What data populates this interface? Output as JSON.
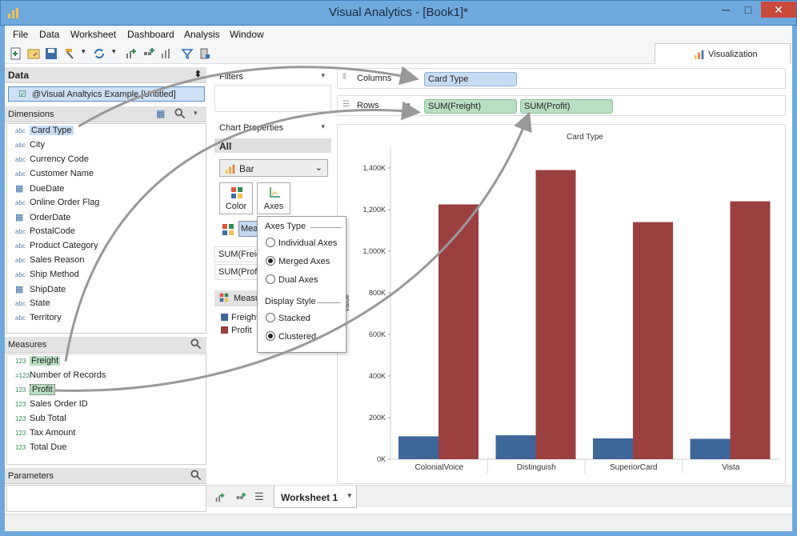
{
  "window": {
    "title": "Visual Analytics - [Book1]*",
    "min": "─",
    "max": "□",
    "close": "✕"
  },
  "menu": [
    "File",
    "Data",
    "Worksheet",
    "Dashboard",
    "Analysis",
    "Window"
  ],
  "toolbar": {
    "visualization_tab": "Visualization"
  },
  "data_pane": {
    "header": "Data",
    "source": "@Visual Analtyics Example [Untitled]",
    "dimensions_header": "Dimensions",
    "dimensions": [
      {
        "type": "abc",
        "name": "Card Type"
      },
      {
        "type": "abc",
        "name": "City"
      },
      {
        "type": "abc",
        "name": "Currency Code"
      },
      {
        "type": "abc",
        "name": "Customer Name"
      },
      {
        "type": "date",
        "name": "DueDate"
      },
      {
        "type": "abc",
        "name": "Online Order Flag"
      },
      {
        "type": "date",
        "name": "OrderDate"
      },
      {
        "type": "abc",
        "name": "PostalCode"
      },
      {
        "type": "abc",
        "name": "Product Category"
      },
      {
        "type": "abc",
        "name": "Sales Reason"
      },
      {
        "type": "abc",
        "name": "Ship Method"
      },
      {
        "type": "date",
        "name": "ShipDate"
      },
      {
        "type": "abc",
        "name": "State"
      },
      {
        "type": "abc",
        "name": "Territory"
      }
    ],
    "measures_header": "Measures",
    "measures": [
      {
        "type": "123",
        "name": "Freight"
      },
      {
        "type": "=123",
        "name": "Number of Records"
      },
      {
        "type": "123",
        "name": "Profit"
      },
      {
        "type": "123",
        "name": "Sales Order ID"
      },
      {
        "type": "123",
        "name": "Sub Total"
      },
      {
        "type": "123",
        "name": "Tax Amount"
      },
      {
        "type": "123",
        "name": "Total Due"
      }
    ],
    "parameters_header": "Parameters"
  },
  "middle": {
    "filters": "Filters",
    "chart_properties": "Chart Properties",
    "all": "All",
    "chart_type": "Bar",
    "color": "Color",
    "axes": "Axes",
    "measures_chip": "Measures",
    "sum_freight": "SUM(Freight)",
    "sum_profit": "SUM(Profit)",
    "measure_values": "Measure Values",
    "legend": [
      {
        "name": "Freight",
        "color": "#3d6699"
      },
      {
        "name": "Profit",
        "color": "#9b3f3f"
      }
    ]
  },
  "axes_popup": {
    "axes_type": "Axes Type",
    "options_type": [
      {
        "label": "Individual Axes",
        "selected": false
      },
      {
        "label": "Merged Axes",
        "selected": true
      },
      {
        "label": "Dual Axes",
        "selected": false
      }
    ],
    "display_style": "Display Style",
    "options_style": [
      {
        "label": "Stacked",
        "selected": false
      },
      {
        "label": "Clustered",
        "selected": true
      }
    ]
  },
  "shelves": {
    "columns_label": "Columns",
    "columns_pill": "Card Type",
    "rows_label": "Rows",
    "rows_pills": [
      "SUM(Freight)",
      "SUM(Profit)"
    ]
  },
  "chart_data": {
    "type": "bar",
    "title": "Card Type",
    "categories": [
      "ColonialVoice",
      "Distinguish",
      "SuperiorCard",
      "Vista"
    ],
    "series": [
      {
        "name": "Freight",
        "values": [
          110000,
          115000,
          100000,
          98000
        ],
        "color": "#3d6699"
      },
      {
        "name": "Profit",
        "values": [
          1225000,
          1390000,
          1140000,
          1240000
        ],
        "color": "#9b3f3f"
      }
    ],
    "yticks": [
      "0K",
      "200K",
      "400K",
      "600K",
      "800K",
      "1,000K",
      "1,200K",
      "1,400K"
    ],
    "ylim": [
      0,
      1500000
    ],
    "ylabel": "Value",
    "grid": false
  },
  "tabs": {
    "worksheet": "Worksheet 1"
  }
}
